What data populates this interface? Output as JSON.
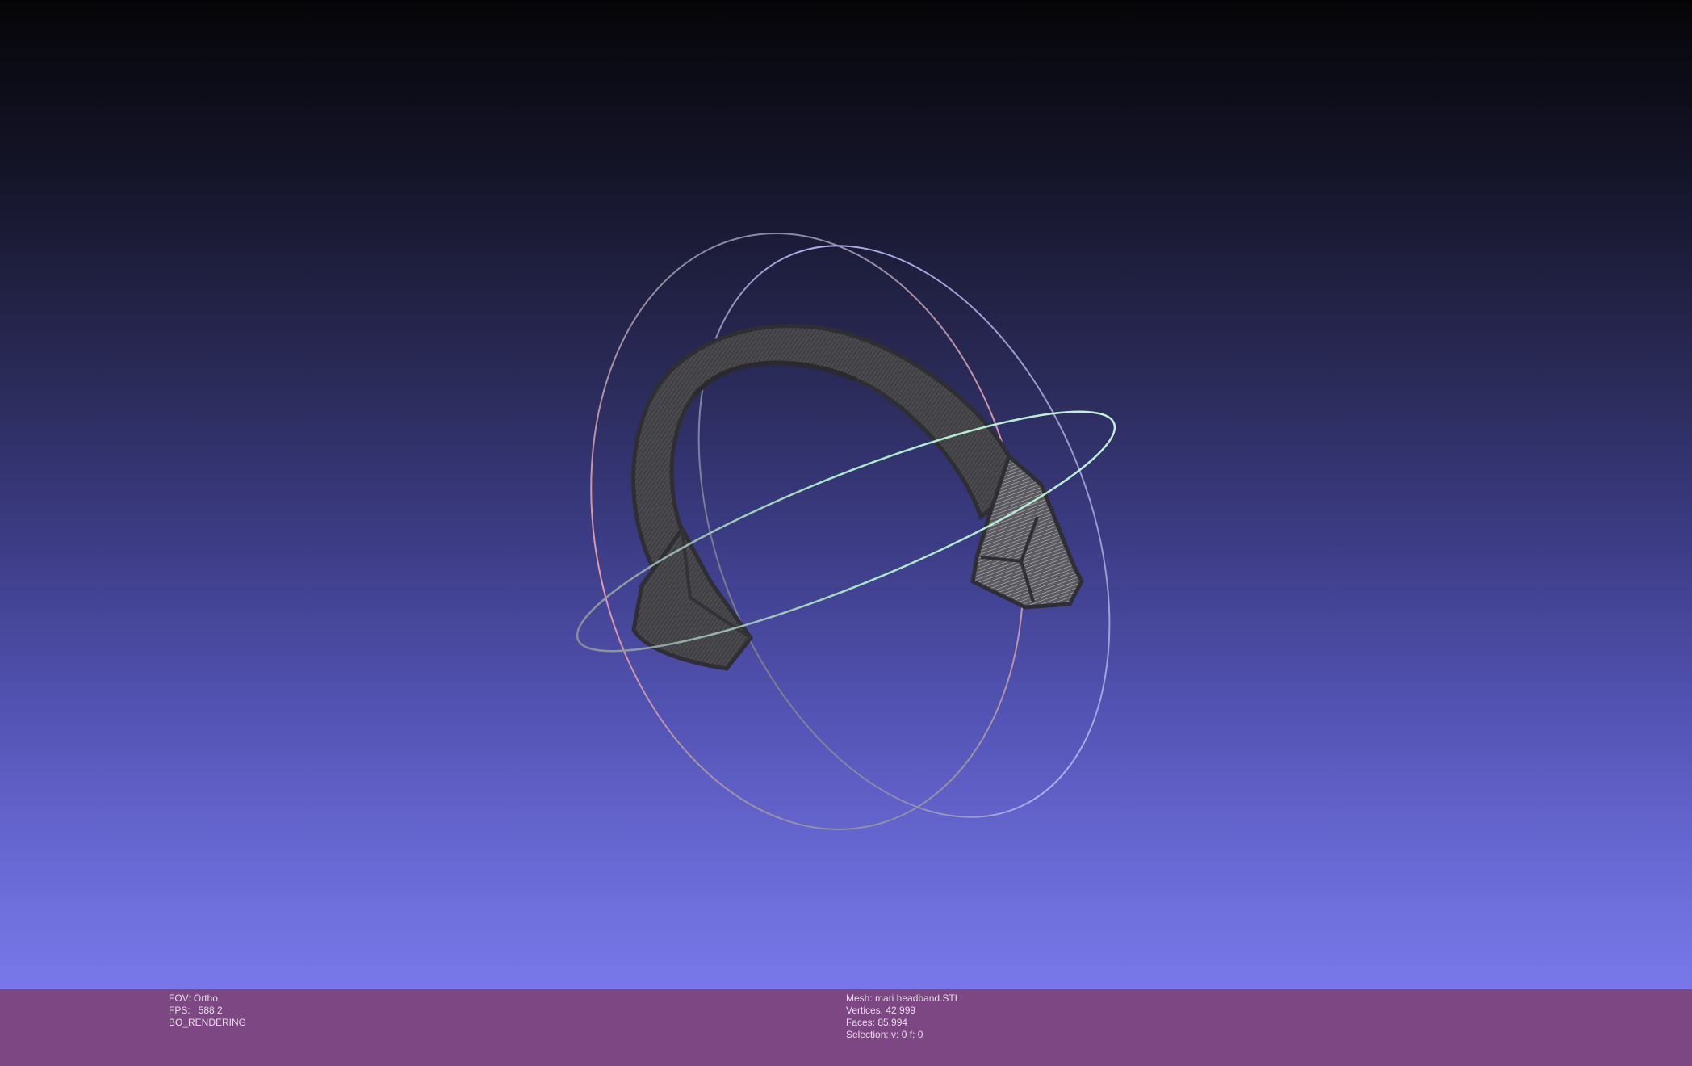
{
  "status_left": {
    "fov": "FOV: Ortho",
    "fps": "FPS:   588.2",
    "mode": "BO_RENDERING"
  },
  "status_right": {
    "mesh": "Mesh: mari headband.STL",
    "vertices": "Vertices: 42,999",
    "faces": "Faces: 85,994",
    "selection": "Selection: v: 0 f: 0"
  },
  "colors": {
    "background_top": "#050508",
    "background_bottom": "#7878ea",
    "status_bar": "#7d4784",
    "mesh": "#3c3c3e",
    "trackball_x": "#e89aa8",
    "trackball_y": "#b0b0f0",
    "trackball_z": "#a8e8c8"
  }
}
